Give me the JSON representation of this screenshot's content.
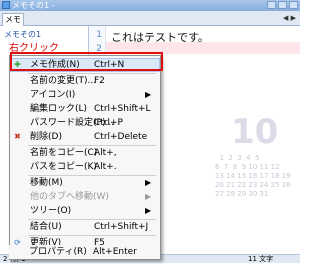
{
  "window": {
    "title": "メモその1 -"
  },
  "tab": {
    "label": "メモ"
  },
  "tree": {
    "item": "メモその1",
    "annotation": "右クリック"
  },
  "editor": {
    "line1_number": "1",
    "line2_number": "2",
    "line1_text": "これはテストです。"
  },
  "calendar": {
    "big": "10",
    "rows": [
      "  1  2  3  4  5",
      "6  7  8  9 10 11 12",
      "13 14 15 16 17 18 19",
      "20 21 22 23 24 25 26",
      "27 28 29 30 31"
    ]
  },
  "status": {
    "left": "2 行, 1",
    "right": "11 文字"
  },
  "menu": {
    "items": [
      {
        "label": "メモ作成(N)",
        "shortcut": "Ctrl+N",
        "icon": "new-memo-icon"
      },
      {
        "label": "名前の変更(T)...",
        "shortcut": "F2"
      },
      {
        "label": "アイコン(I)",
        "shortcut": ""
      },
      {
        "label": "編集ロック(L)",
        "shortcut": "Ctrl+Shift+L"
      },
      {
        "label": "パスワード設定(P)...",
        "shortcut": "Ctrl+P"
      },
      {
        "label": "削除(D)",
        "shortcut": "Ctrl+Delete",
        "icon": "delete-icon"
      },
      {
        "label": "名前をコピー(C)",
        "shortcut": "Alt+,"
      },
      {
        "label": "パスをコピー(K)",
        "shortcut": "Alt+."
      },
      {
        "label": "移動(M)",
        "shortcut": ""
      },
      {
        "label": "他のタブへ移動(W)",
        "shortcut": ""
      },
      {
        "label": "ツリー(O)",
        "shortcut": ""
      },
      {
        "label": "結合(U)",
        "shortcut": "Ctrl+Shift+J"
      },
      {
        "label": "更新(V)",
        "shortcut": "F5",
        "icon": "refresh-icon"
      },
      {
        "label": "プロパティ(R)",
        "shortcut": "Alt+Enter"
      }
    ]
  }
}
